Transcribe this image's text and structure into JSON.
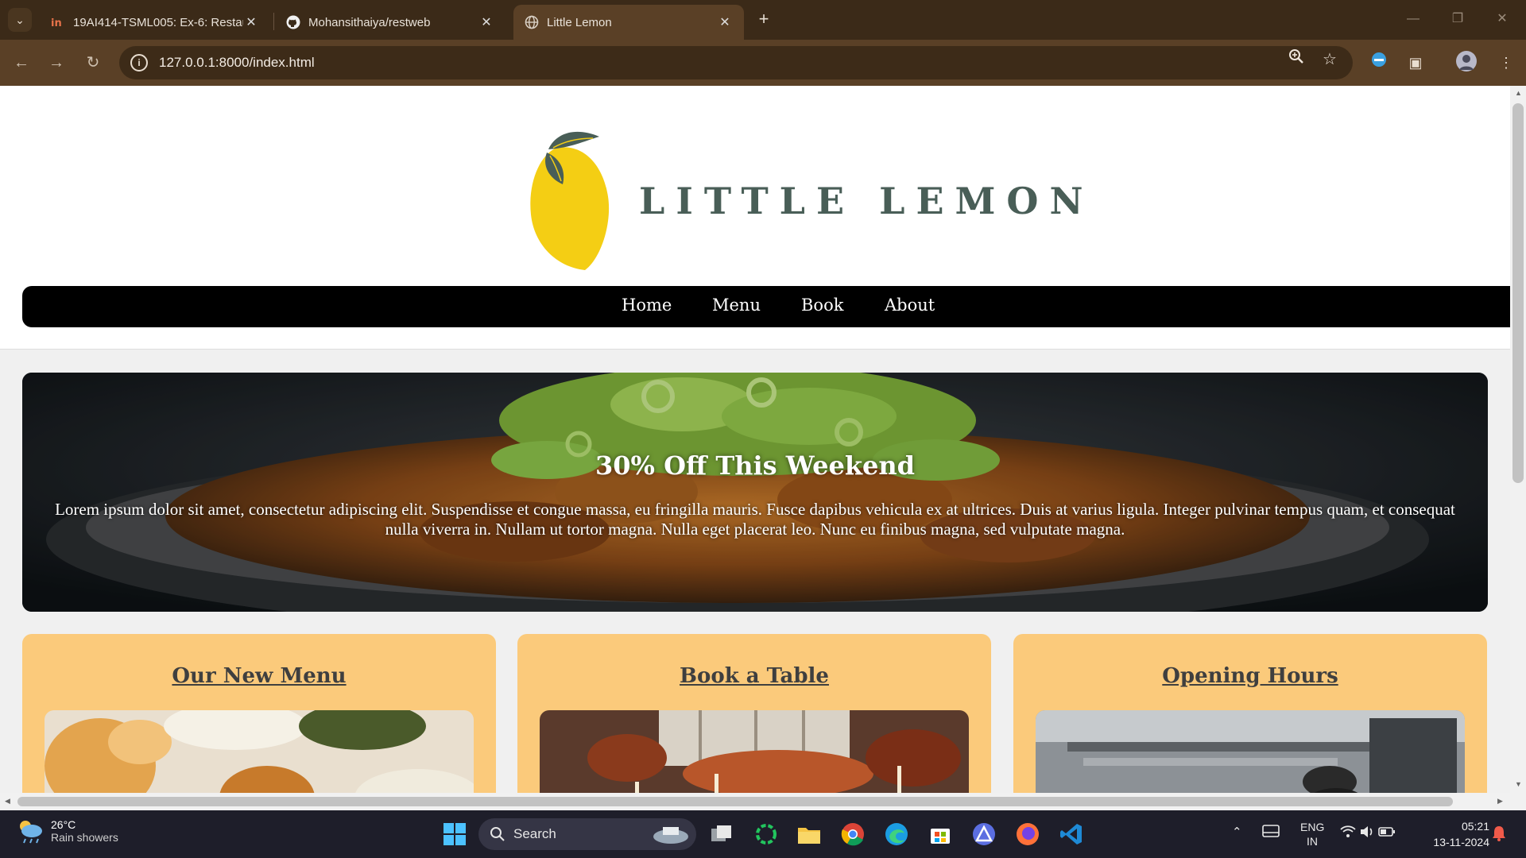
{
  "browser": {
    "tabs": [
      {
        "title": "19AI414-TSML005: Ex-6: Restau",
        "active": false,
        "icon": "in-favicon"
      },
      {
        "title": "Mohansithaiya/restweb",
        "active": false,
        "icon": "github-icon"
      },
      {
        "title": "Little Lemon",
        "active": true,
        "icon": "globe-icon"
      }
    ],
    "url": "127.0.0.1:8000/index.html"
  },
  "site": {
    "brand": "LITTLE LEMON",
    "nav": [
      "Home",
      "Menu",
      "Book",
      "About"
    ],
    "hero": {
      "title": "30% Off This Weekend",
      "text": "Lorem ipsum dolor sit amet, consectetur adipiscing elit. Suspendisse et congue massa, eu fringilla mauris. Fusce dapibus vehicula ex at ultrices. Duis at varius ligula. Integer pulvinar tempus quam, et consequat nulla viverra in. Nullam ut tortor magna. Nulla eget placerat leo. Nunc eu finibus magna, sed vulputate magna."
    },
    "cards": [
      {
        "title": "Our New Menu"
      },
      {
        "title": "Book a Table"
      },
      {
        "title": "Opening Hours"
      }
    ]
  },
  "taskbar": {
    "weather": {
      "temp": "26°C",
      "desc": "Rain showers"
    },
    "search_label": "Search",
    "lang": {
      "line1": "ENG",
      "line2": "IN"
    },
    "time": "05:21",
    "date": "13-11-2024"
  },
  "colors": {
    "brand_green": "#495e57",
    "lemon_yellow": "#f4ce14",
    "card_bg": "#fbca7b",
    "chrome_brown": "#5a4026"
  }
}
